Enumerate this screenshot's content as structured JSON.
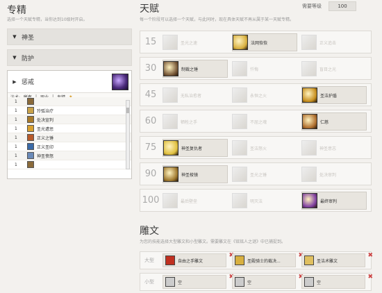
{
  "spec": {
    "title": "专精",
    "subtitle": "选择一个天赋专精，当你达到10级时开启。",
    "collapsed": [
      "神圣",
      "防护"
    ],
    "open": {
      "name": "惩戒",
      "filter": {
        "label": "法术:",
        "options": [
          "所有",
          "职业",
          "专精"
        ],
        "star": "★"
      },
      "spells": [
        {
          "level": "1",
          "name": "",
          "color": "#8a6a3a"
        },
        {
          "level": "1",
          "name": "玲弧治疗",
          "color": "#c9a24a"
        },
        {
          "level": "1",
          "name": "处决宣判",
          "color": "#a87a2a"
        },
        {
          "level": "1",
          "name": "圣光遭惩",
          "color": "#d8a030"
        },
        {
          "level": "1",
          "name": "正义之锤",
          "color": "#b85a2a"
        },
        {
          "level": "1",
          "name": "正义圣印",
          "color": "#3a6aa8"
        },
        {
          "level": "1",
          "name": "神圣愤怒",
          "color": "#6a8ab8"
        },
        {
          "level": "1",
          "name": "",
          "color": "#8a6a3a"
        }
      ]
    }
  },
  "talents": {
    "title": "天赋",
    "subtitle": "每一个阶段可以选择一个天赋，与此同时，现在具体天赋不再从属于某一天赋专精。",
    "req_label": "需要等级",
    "req_value": "100",
    "tiers": [
      {
        "level": "15",
        "talents": [
          {
            "name": "圣光之速",
            "selected": false,
            "color": "#ccc"
          },
          {
            "name": "法网恢恢",
            "selected": true,
            "color": "#d8b040"
          },
          {
            "name": "正义追击",
            "selected": false,
            "color": "#ccc"
          }
        ]
      },
      {
        "level": "30",
        "talents": [
          {
            "name": "制裁之锤",
            "selected": true,
            "color": "#7a5a3a"
          },
          {
            "name": "忏悔",
            "selected": false,
            "color": "#ccc"
          },
          {
            "name": "盲目之光",
            "selected": false,
            "color": "#ccc"
          }
        ]
      },
      {
        "level": "45",
        "talents": [
          {
            "name": "无私治愈者",
            "selected": false,
            "color": "#ccc"
          },
          {
            "name": "永恒之火",
            "selected": false,
            "color": "#ccc"
          },
          {
            "name": "圣洁护盾",
            "selected": true,
            "color": "#c89020"
          }
        ]
      },
      {
        "level": "60",
        "talents": [
          {
            "name": "牺牲之手",
            "selected": false,
            "color": "#ccc"
          },
          {
            "name": "不屈之魂",
            "selected": false,
            "color": "#ccc"
          },
          {
            "name": "仁慈",
            "selected": true,
            "color": "#b07030"
          }
        ]
      },
      {
        "level": "75",
        "talents": [
          {
            "name": "神圣复仇者",
            "selected": true,
            "color": "#e0c040"
          },
          {
            "name": "圣洁怒火",
            "selected": false,
            "color": "#ccc"
          },
          {
            "name": "神圣意志",
            "selected": false,
            "color": "#ccc"
          }
        ]
      },
      {
        "level": "90",
        "talents": [
          {
            "name": "神圣棱镜",
            "selected": true,
            "color": "#a07a30"
          },
          {
            "name": "圣光之锤",
            "selected": false,
            "color": "#ccc"
          },
          {
            "name": "处决审判",
            "selected": false,
            "color": "#ccc"
          }
        ]
      },
      {
        "level": "100",
        "talents": [
          {
            "name": "最后壁垒",
            "selected": false,
            "color": "#ccc"
          },
          {
            "name": "明灭法",
            "selected": false,
            "color": "#ccc"
          },
          {
            "name": "最终审判",
            "selected": true,
            "color": "#8040a0"
          }
        ]
      }
    ]
  },
  "glyphs": {
    "title": "雕文",
    "subtitle": "为您的技能选择大型雕文和小型雕文。需要雕文在《铭铭人之谜》中已捕捉到。",
    "major_label": "大型",
    "minor_label": "小型",
    "remove_symbol": "✖",
    "major": [
      {
        "name": "自由之手雕文",
        "color": "#c03020"
      },
      {
        "name": "圣殿骑士的裁决...",
        "color": "#d8b040"
      },
      {
        "name": "圣洁术雕文",
        "color": "#e0c060"
      }
    ],
    "minor": [
      {
        "name": "空",
        "color": "#ccc"
      },
      {
        "name": "空",
        "color": "#ccc"
      },
      {
        "name": "空",
        "color": "#ccc"
      }
    ]
  }
}
